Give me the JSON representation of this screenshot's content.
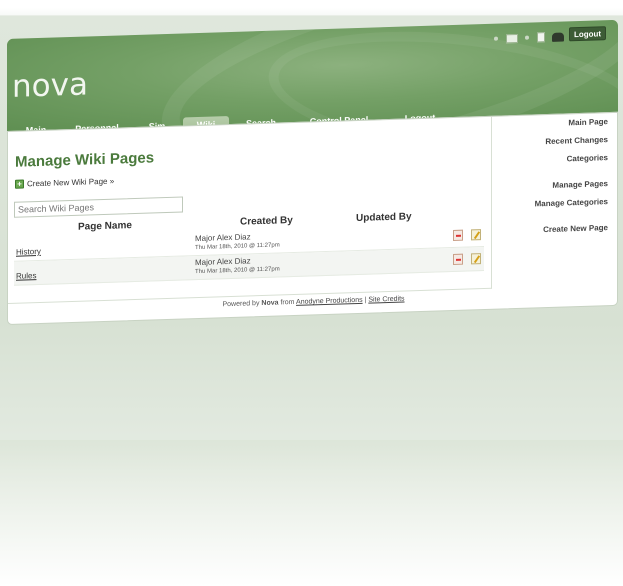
{
  "app": {
    "logo_text": "nova",
    "top_logout": "Logout"
  },
  "nav": {
    "tabs": [
      {
        "label": "Main",
        "active": false
      },
      {
        "label": "Personnel",
        "active": false
      },
      {
        "label": "Sim",
        "active": false
      },
      {
        "label": "Wiki",
        "active": true
      },
      {
        "label": "Search",
        "active": false
      },
      {
        "label": "Control Panel",
        "active": false
      },
      {
        "label": "Logout",
        "active": false
      }
    ]
  },
  "main": {
    "title": "Manage Wiki Pages",
    "create_link": "Create New Wiki Page »",
    "search_placeholder": "Search Wiki Pages",
    "columns": {
      "page_name": "Page Name",
      "created_by": "Created By",
      "updated_by": "Updated By"
    },
    "rows": [
      {
        "name": "History",
        "author": "Major Alex Diaz",
        "date": "Thu Mar 18th, 2010 @ 11:27pm"
      },
      {
        "name": "Rules",
        "author": "Major Alex Diaz",
        "date": "Thu Mar 18th, 2010 @ 11:27pm"
      }
    ]
  },
  "sidebar": {
    "items": [
      {
        "label": "Main Page"
      },
      {
        "label": "Recent Changes"
      },
      {
        "label": "Categories"
      },
      {
        "label": "Manage Pages"
      },
      {
        "label": "Manage Categories"
      },
      {
        "label": "Create New Page"
      }
    ]
  },
  "footer": {
    "powered_by": "Powered by",
    "product": "Nova",
    "from": "from",
    "company": "Anodyne Productions",
    "separator": "|",
    "credits": "Site Credits"
  },
  "colors": {
    "header_green": "#74a066",
    "title_green": "#4a7a3c",
    "logout_bg": "#3d5c36"
  }
}
